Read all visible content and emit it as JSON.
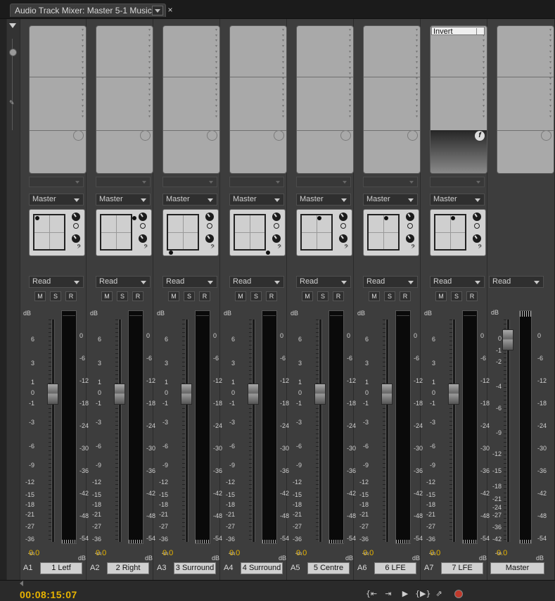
{
  "tab": {
    "title": "Audio Track Mixer: Master 5-1 Music",
    "close": "×"
  },
  "units": {
    "db": "dB"
  },
  "channels": [
    {
      "id": "A1",
      "name": "1 Letf",
      "output": "Master",
      "automation": "Read",
      "volume": "0.0",
      "fader_db": 0
    },
    {
      "id": "A2",
      "name": "2 Right",
      "output": "Master",
      "automation": "Read",
      "volume": "0.0",
      "fader_db": 0
    },
    {
      "id": "A3",
      "name": "3 Surround",
      "output": "Master",
      "automation": "Read",
      "volume": "0.0",
      "fader_db": 0
    },
    {
      "id": "A4",
      "name": "4 Surround",
      "output": "Master",
      "automation": "Read",
      "volume": "0.0",
      "fader_db": 0
    },
    {
      "id": "A5",
      "name": "5 Centre",
      "output": "Master",
      "automation": "Read",
      "volume": "0.0",
      "fader_db": 0
    },
    {
      "id": "A6",
      "name": "6 LFE",
      "output": "Master",
      "automation": "Read",
      "volume": "0.0",
      "fader_db": 0
    },
    {
      "id": "A7",
      "name": "7 LFE",
      "output": "Master",
      "automation": "Read",
      "volume": "0.0",
      "fader_db": 0,
      "effect": "Invert"
    }
  ],
  "master": {
    "name": "Master",
    "automation": "Read",
    "volume": "0.0"
  },
  "msr": [
    "M",
    "S",
    "R"
  ],
  "fader_scale": [
    "6",
    "3",
    "1",
    "0",
    "-1",
    "-3",
    "-6",
    "-9",
    "-12",
    "-15",
    "-18",
    "-21",
    "-27",
    "-36",
    "-∞"
  ],
  "master_fader_scale": [
    "0",
    "-1",
    "-2",
    "-4",
    "-6",
    "-9",
    "-12",
    "-15",
    "-18",
    "-21",
    "-24",
    "-27",
    "-36",
    "-42",
    "-∞"
  ],
  "meter_scale": [
    "0",
    "-6",
    "-12",
    "-18",
    "-24",
    "-30",
    "-36",
    "-42",
    "-48",
    "-54",
    "dB"
  ],
  "timecode": "00:08:15:07",
  "transport": [
    "go-to-in-icon",
    "step-forward-icon",
    "play-icon",
    "play-in-to-out-icon",
    "loop-icon",
    "record-icon"
  ],
  "colors": {
    "timecode": "#e8b400",
    "record": "#c0392b"
  }
}
